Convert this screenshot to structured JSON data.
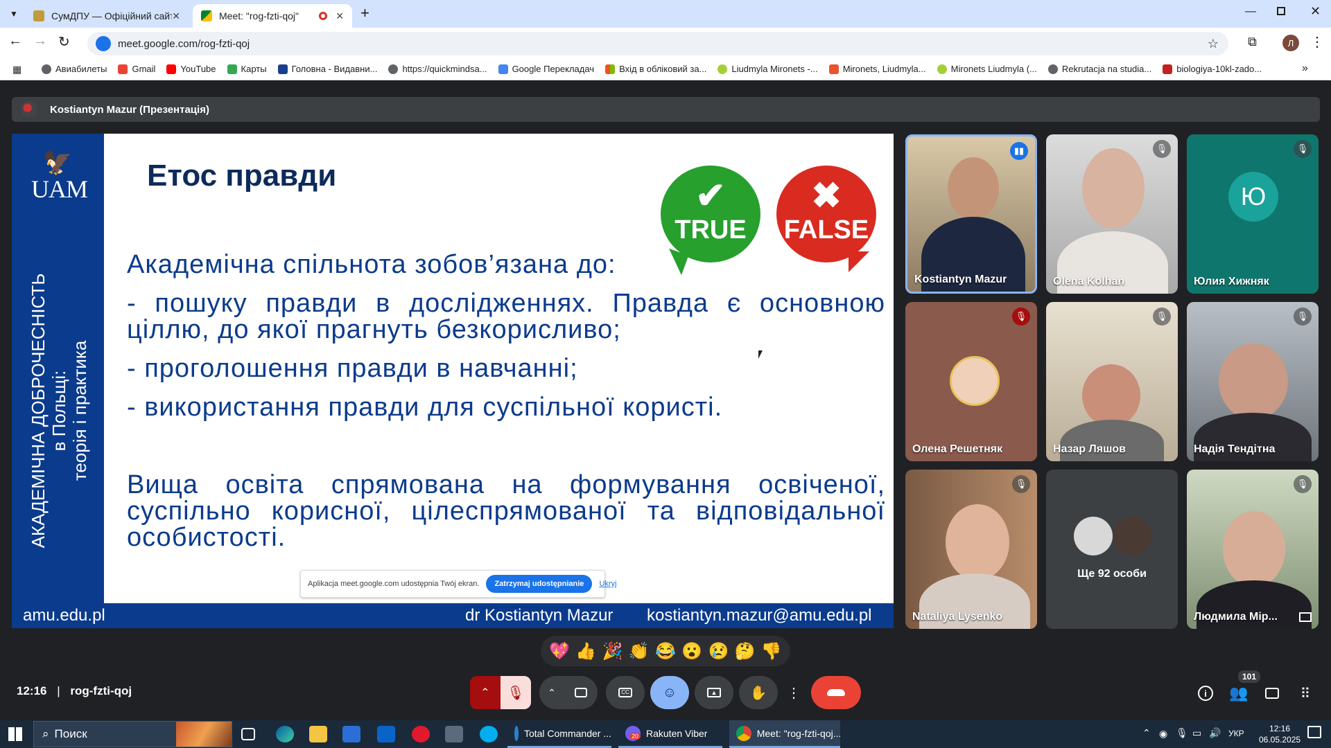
{
  "browser": {
    "tabs": [
      {
        "title": "СумДПУ — Офіційний сайт Су",
        "active": false
      },
      {
        "title": "Meet: \"rog-fzti-qoj\"",
        "active": true
      }
    ],
    "new_tab_label": "+",
    "url": "meet.google.com/rog-fzti-qoj",
    "bookmarks": [
      "Авиабилеты",
      "Gmail",
      "YouTube",
      "Карты",
      "Головна - Видавни...",
      "https://quickmindsa...",
      "Google Перекладач",
      "Вхід в обліковий за...",
      "Liudmyla Mironets -...",
      "Mironets, Liudmyla...",
      "Mironets Liudmyla (...",
      "Rekrutacja na studia...",
      "biologiya-10kl-zado..."
    ],
    "profile_initial": "Л"
  },
  "meet": {
    "presenter_label": "Kostiantyn Mazur (Презентація)",
    "slide": {
      "logo_text": "UAM",
      "vertical_line1": "АКАДЕМІЧНА ДОБРОЧЕСНІСТЬ",
      "vertical_line2": "в Польщі:",
      "vertical_line3": "теорія і практика",
      "title": "Етос правди",
      "true_label": "TRUE",
      "false_label": "FALSE",
      "line1": "Академічна спільнота зобов’язана до:",
      "line2": "- пошуку правди в дослідженнях. Правда є основною ціллю, до якої прагнуть безкорисливо;",
      "line3": "- проголошення правди в навчанні;",
      "line4": "- використання правди для суспільної користі.",
      "line5": "Вища освіта спрямована на формування освіченої, суспільно корисної, цілеспрямованої та відповідальної особистості.",
      "footer_site": "amu.edu.pl",
      "footer_author": "dr Kostiantyn Mazur",
      "footer_email": "kostiantyn.mazur@amu.edu.pl"
    },
    "share_banner": {
      "text": "Aplikacja meet.google.com udostępnia Twój ekran.",
      "stop_label": "Zatrzymaj udostępnianie",
      "hide_label": "Ukryj"
    },
    "participants": [
      "Kostiantyn Mazur",
      "Olena Kolhan",
      "Юлия Хижняк",
      "Олена Решетняк",
      "Назар Ляшов",
      "Надія Тендітна",
      "Nataliya Lysenko",
      "Ще 92 особи",
      "Людмила Мір..."
    ],
    "avatar_initial": "Ю",
    "reactions": [
      "💖",
      "👍",
      "🎉",
      "👏",
      "😂",
      "😮",
      "😢",
      "🤔",
      "👎"
    ],
    "clock": "12:16",
    "meeting_code": "rog-fzti-qoj",
    "people_count": "101"
  },
  "taskbar": {
    "search_placeholder": "Поиск",
    "apps": [
      "Total Commander ...",
      "Rakuten Viber",
      "Meet: \"rog-fzti-qoj..."
    ],
    "viber_badge": "20",
    "language": "УКР",
    "time": "12:16",
    "date": "06.05.2025"
  },
  "colors": {
    "slide_blue": "#0b3b8c",
    "true_green": "#27a02e",
    "false_red": "#d92b1f",
    "end_call_red": "#ea4335",
    "emoji_button_blue": "#8ab4f8"
  }
}
